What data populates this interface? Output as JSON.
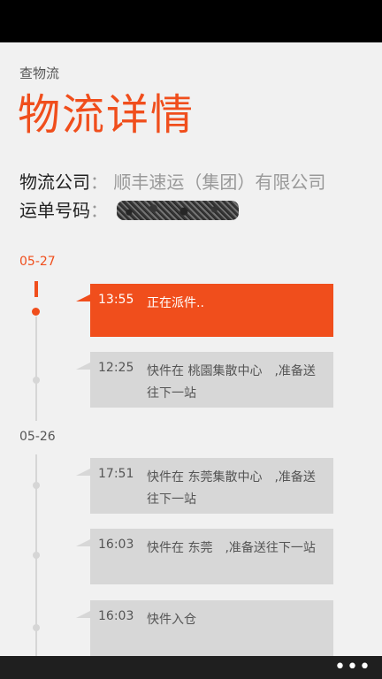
{
  "header": {
    "app_title": "查物流",
    "page_title": "物流详情"
  },
  "info": {
    "company_label": "物流公司",
    "separator": "：",
    "company_value": "顺丰速运（集团）有限公司",
    "tracking_label": "运单号码"
  },
  "timeline": {
    "groups": [
      {
        "date": "05-27",
        "events": [
          {
            "time": "13:55",
            "text": "正在派件..",
            "active": true
          },
          {
            "time": "12:25",
            "text": "快件在 桃園集散中心　,准备送往下一站",
            "active": false
          }
        ]
      },
      {
        "date": "05-26",
        "events": [
          {
            "time": "17:51",
            "text": "快件在 东莞集散中心　,准备送往下一站",
            "active": false
          },
          {
            "time": "16:03",
            "text": "快件在 东莞　,准备送往下一站",
            "active": false
          },
          {
            "time": "16:03",
            "text": "快件入仓",
            "active": false
          }
        ]
      }
    ]
  },
  "app_bar": {
    "more_icon": "more-dots-icon",
    "more_label": "•••"
  },
  "colors": {
    "accent": "#f04e1c",
    "card_bg": "#d7d7d7",
    "page_bg": "#f1f1f1"
  }
}
